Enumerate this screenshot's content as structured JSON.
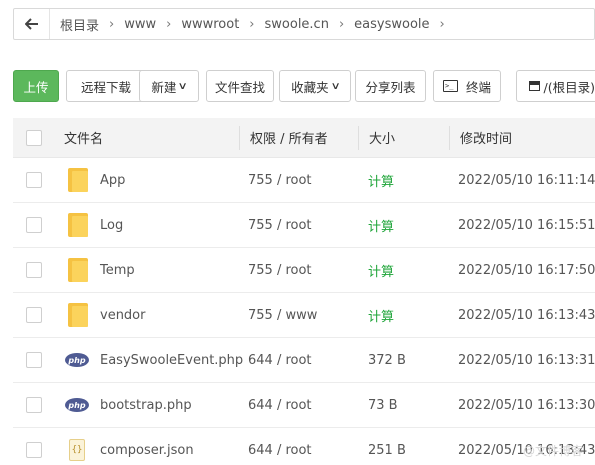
{
  "path": {
    "back_icon": "arrow-left-icon",
    "crumbs": [
      "根目录",
      "www",
      "wwwroot",
      "swoole.cn",
      "easyswoole"
    ]
  },
  "toolbar": {
    "upload": "上传",
    "remote_download": "远程下载",
    "new": "新建",
    "file_search": "文件查找",
    "favorites": "收藏夹",
    "share_list": "分享列表",
    "terminal": "终端",
    "root_dir": "/(根目录)"
  },
  "table": {
    "headers": {
      "name": "文件名",
      "perm_owner": "权限 / 所有者",
      "size": "大小",
      "mtime": "修改时间"
    },
    "rows": [
      {
        "type": "folder",
        "name": "App",
        "perm": "755 / root",
        "size": "计算",
        "mtime": "2022/05/10 16:11:14"
      },
      {
        "type": "folder",
        "name": "Log",
        "perm": "755 / root",
        "size": "计算",
        "mtime": "2022/05/10 16:15:51"
      },
      {
        "type": "folder",
        "name": "Temp",
        "perm": "755 / root",
        "size": "计算",
        "mtime": "2022/05/10 16:17:50"
      },
      {
        "type": "folder",
        "name": "vendor",
        "perm": "755 / www",
        "size": "计算",
        "mtime": "2022/05/10 16:13:43"
      },
      {
        "type": "php",
        "name": "EasySwooleEvent.php",
        "perm": "644 / root",
        "size": "372 B",
        "mtime": "2022/05/10 16:13:31"
      },
      {
        "type": "php",
        "name": "bootstrap.php",
        "perm": "644 / root",
        "size": "73 B",
        "mtime": "2022/05/10 16:13:30"
      },
      {
        "type": "json",
        "name": "composer.json",
        "perm": "644 / root",
        "size": "251 B",
        "mtime": "2022/05/10 16:13:43"
      }
    ]
  },
  "icons": {
    "php_text": "php",
    "json_text": "{}"
  },
  "colors": {
    "primary": "#5cb85c",
    "calc": "#20a53a",
    "folder": "#f5c242"
  },
  "watermark": "@文件博客"
}
